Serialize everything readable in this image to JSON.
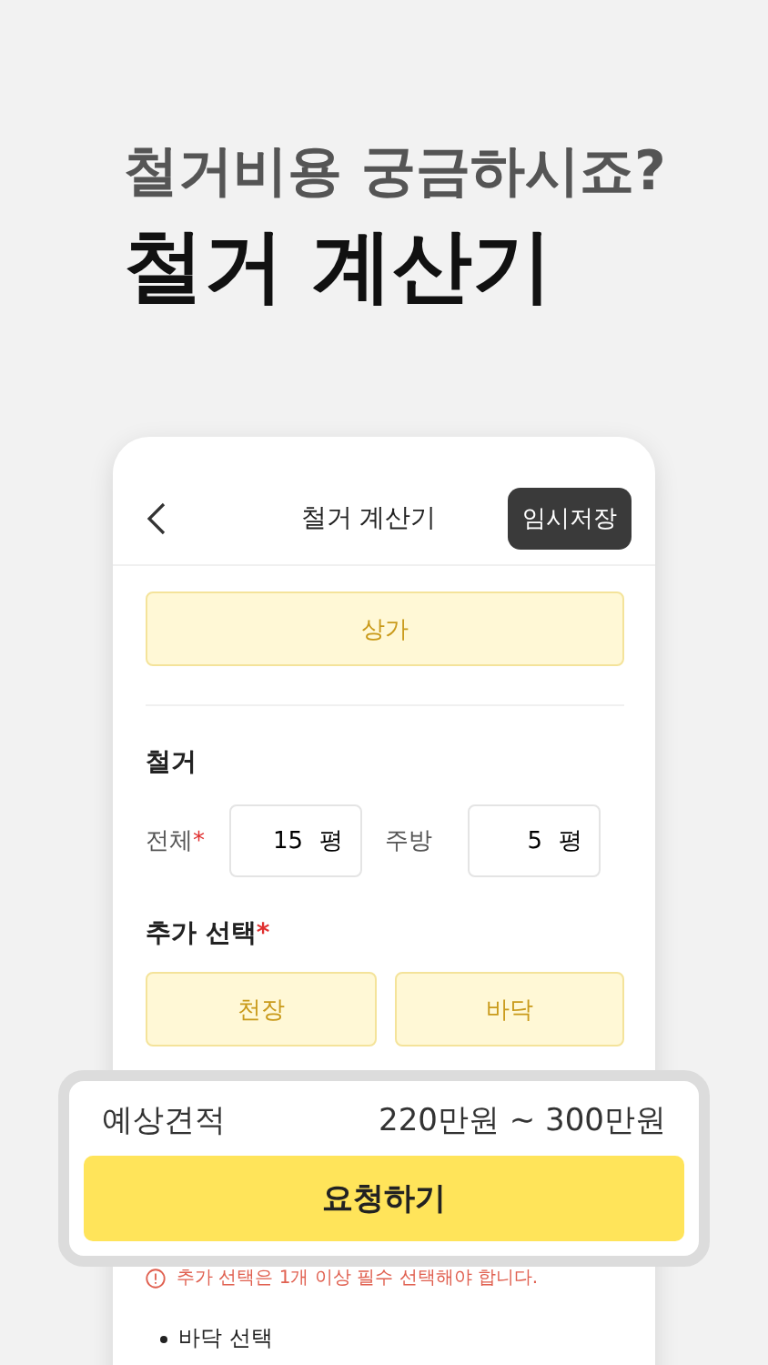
{
  "headline": {
    "subtitle": "철거비용 궁금하시죠?",
    "title": "철거 계산기"
  },
  "app_bar": {
    "title": "철거 계산기",
    "action": "임시저장"
  },
  "building_type": {
    "label": "상가"
  },
  "section_title": "철거",
  "area_fields": [
    {
      "label": "전체",
      "marker": "*",
      "value": "15",
      "unit": "평"
    },
    {
      "label": "주방",
      "value": "5",
      "unit": "평"
    }
  ],
  "extra": {
    "label": "추가 선택",
    "marker": "*",
    "options": [
      {
        "label": "천장"
      },
      {
        "label": "바닥"
      }
    ]
  },
  "warning": "추가 선택은 1개 이상 필수 선택해야 합니다.",
  "bullet": "바닥 선택",
  "estimate": {
    "label": "예상견적",
    "value": "220만원 ~ 300만원"
  },
  "request_button": "요청하기"
}
